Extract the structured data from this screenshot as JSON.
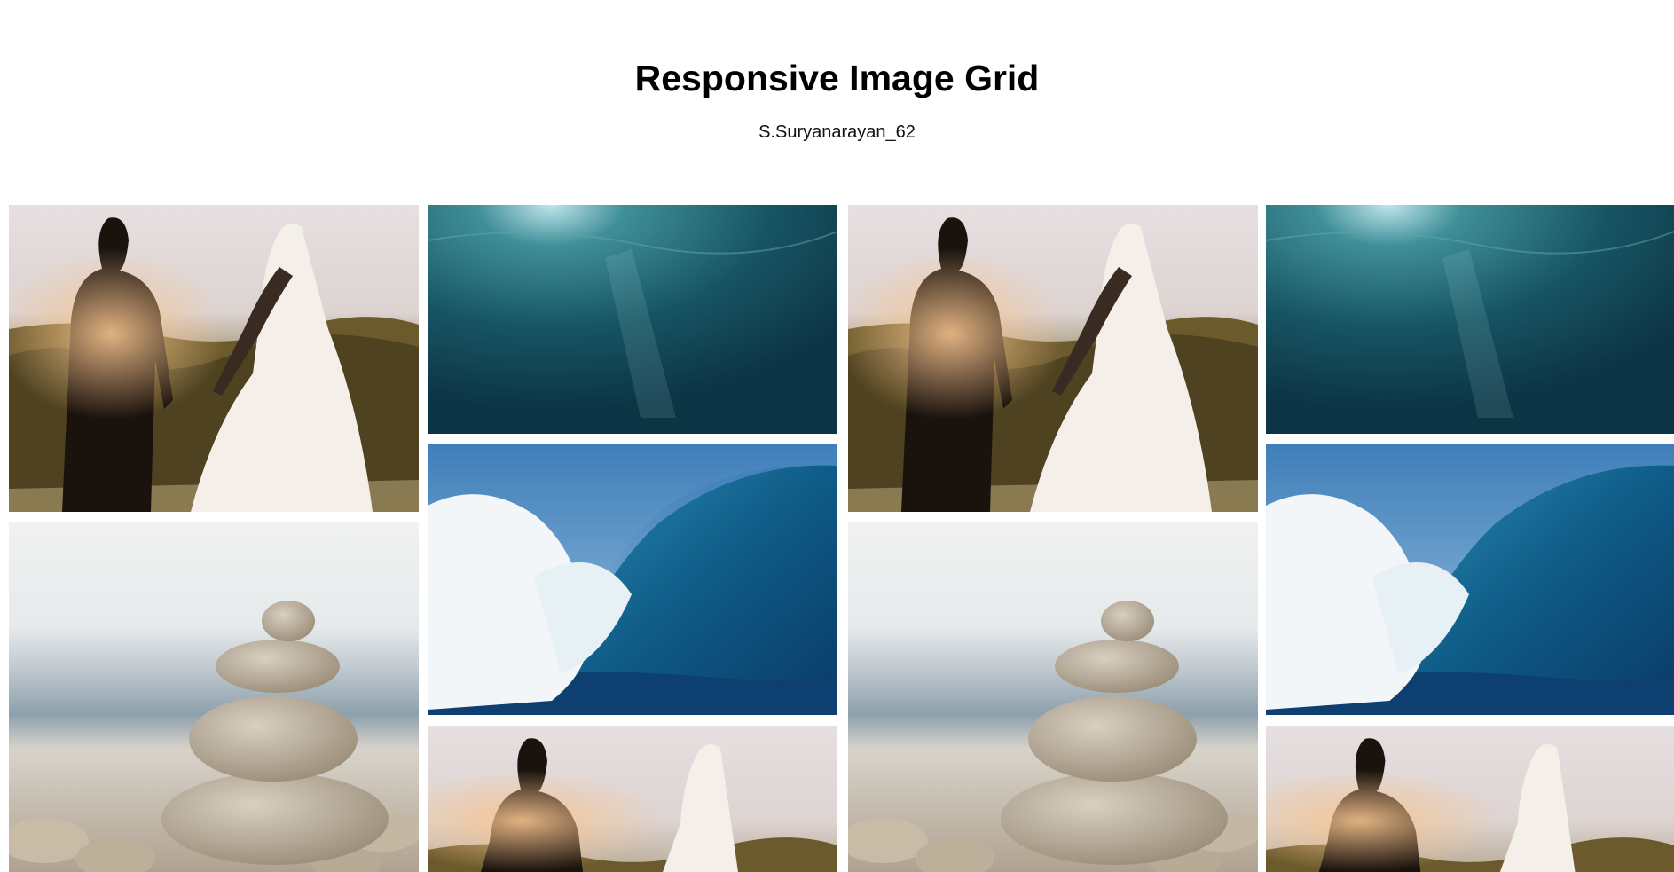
{
  "page": {
    "title": "Responsive Image Grid",
    "subtitle": "S.Suryanarayan_62"
  },
  "grid": {
    "columns": [
      {
        "tiles": [
          {
            "image": "wedding-couple"
          },
          {
            "image": "stone-cairn"
          }
        ]
      },
      {
        "tiles": [
          {
            "image": "underwater-light"
          },
          {
            "image": "ocean-wave"
          },
          {
            "image": "wedding-couple"
          }
        ]
      },
      {
        "tiles": [
          {
            "image": "wedding-couple"
          },
          {
            "image": "stone-cairn"
          }
        ]
      },
      {
        "tiles": [
          {
            "image": "underwater-light"
          },
          {
            "image": "ocean-wave"
          },
          {
            "image": "wedding-couple"
          }
        ]
      }
    ]
  }
}
